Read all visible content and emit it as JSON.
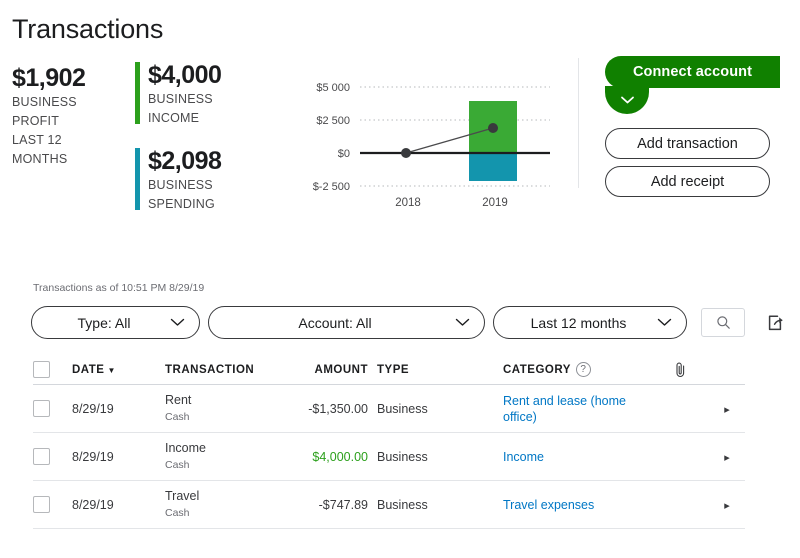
{
  "header": {
    "title": "Transactions"
  },
  "colors": {
    "green": "#2ca01c",
    "green_dark": "#108000",
    "teal": "#1395ad",
    "link_blue": "#0077c5",
    "chart_green": "#3aaa35"
  },
  "kpis": {
    "profit": {
      "amount": "$1,902",
      "label_lines": [
        "BUSINESS",
        "PROFIT",
        "LAST 12",
        "MONTHS"
      ]
    },
    "income": {
      "amount": "$4,000",
      "label_lines": [
        "BUSINESS",
        "INCOME"
      ],
      "accent": "#2ca01c"
    },
    "spending": {
      "amount": "$2,098",
      "label_lines": [
        "BUSINESS",
        "SPENDING"
      ],
      "accent": "#1395ad"
    }
  },
  "chart_data": {
    "type": "bar",
    "title": "",
    "xlabel": "",
    "ylabel": "",
    "categories": [
      "2018",
      "2019"
    ],
    "ytick_labels": [
      "$5 000",
      "$2 500",
      "$0",
      "$-2 500"
    ],
    "ytick_values": [
      5000,
      2500,
      0,
      -2500
    ],
    "ylim": [
      -2500,
      5000
    ],
    "grid": true,
    "legend": "none",
    "series": [
      {
        "name": "Business income",
        "type": "bar",
        "color": "#3aaa35",
        "values": [
          0,
          4000
        ]
      },
      {
        "name": "Business spending",
        "type": "bar",
        "color": "#1395ad",
        "values": [
          0,
          -2098
        ]
      },
      {
        "name": "Business profit",
        "type": "line",
        "color": "#393a3d",
        "values": [
          0,
          1902
        ]
      }
    ]
  },
  "actions": {
    "connect_account": "Connect account",
    "connect_caret_icon": "chevron-down-icon",
    "add_transaction": "Add transaction",
    "add_receipt": "Add receipt"
  },
  "timestamp": "Transactions as of 10:51 PM 8/29/19",
  "filters": {
    "type": {
      "label": "Type: All",
      "caret_icon": "chevron-down-icon"
    },
    "account": {
      "label": "Account: All",
      "caret_icon": "chevron-down-icon"
    },
    "period": {
      "label": "Last 12 months",
      "caret_icon": "chevron-down-icon"
    },
    "search_icon": "search-icon",
    "export_icon": "export-icon"
  },
  "table": {
    "headers": {
      "date": "DATE",
      "sort_caret": "▼",
      "transaction": "TRANSACTION",
      "amount": "AMOUNT",
      "type": "TYPE",
      "category": "CATEGORY",
      "help_icon": "?",
      "attachment_icon": "paperclip-icon"
    },
    "rows": [
      {
        "date": "8/29/19",
        "transaction": "Rent",
        "account": "Cash",
        "amount": "-$1,350.00",
        "amount_sign": "negative",
        "type": "Business",
        "category": "Rent and lease (home office)",
        "caret": "▸"
      },
      {
        "date": "8/29/19",
        "transaction": "Income",
        "account": "Cash",
        "amount": "$4,000.00",
        "amount_sign": "positive",
        "type": "Business",
        "category": "Income",
        "caret": "▸"
      },
      {
        "date": "8/29/19",
        "transaction": "Travel",
        "account": "Cash",
        "amount": "-$747.89",
        "amount_sign": "negative",
        "type": "Business",
        "category": "Travel expenses",
        "caret": "▸"
      }
    ]
  }
}
